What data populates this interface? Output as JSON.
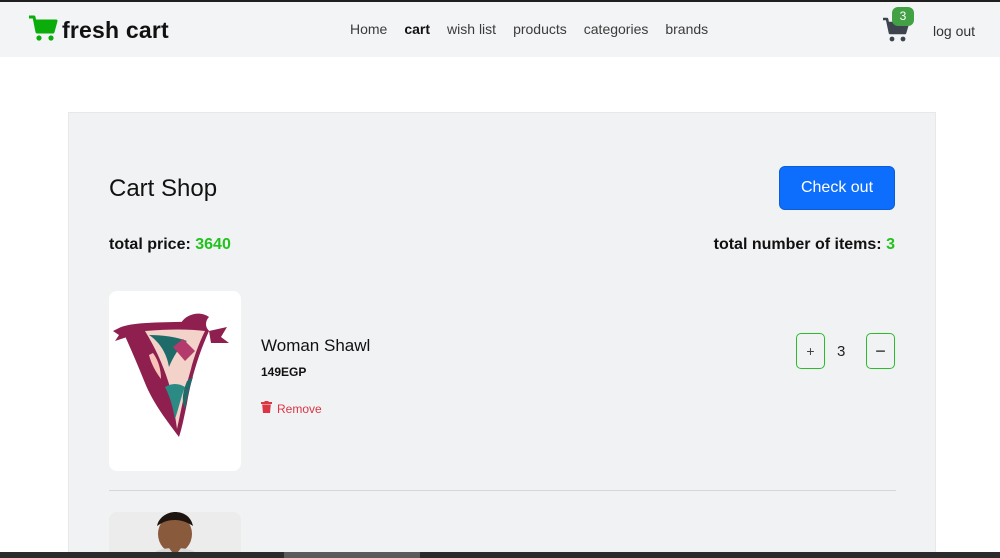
{
  "navbar": {
    "brand": "fresh cart",
    "links": [
      {
        "label": "Home",
        "active": false
      },
      {
        "label": "cart",
        "active": true
      },
      {
        "label": "wish list",
        "active": false
      },
      {
        "label": "products",
        "active": false
      },
      {
        "label": "categories",
        "active": false
      },
      {
        "label": "brands",
        "active": false
      }
    ],
    "cart_count": "3",
    "logout": "log out"
  },
  "cart": {
    "title": "Cart Shop",
    "checkout_label": "Check out",
    "total_price_label": "total price:",
    "total_price_value": "3640",
    "total_items_label": "total number of items:",
    "total_items_value": "3",
    "items": [
      {
        "name": "Woman Shawl",
        "price": "149EGP",
        "remove_label": "Remove",
        "plus_label": "+",
        "quantity": "3",
        "minus_label": "−"
      }
    ]
  },
  "colors": {
    "brand_green": "#0aad0a",
    "accent_green": "#22c21e",
    "primary_blue": "#0d6efd",
    "danger_red": "#dc3545",
    "badge_green": "#42a144"
  },
  "icons": {
    "brand": "cart-icon",
    "navbar_cart": "cart-icon",
    "remove": "trash-icon"
  }
}
